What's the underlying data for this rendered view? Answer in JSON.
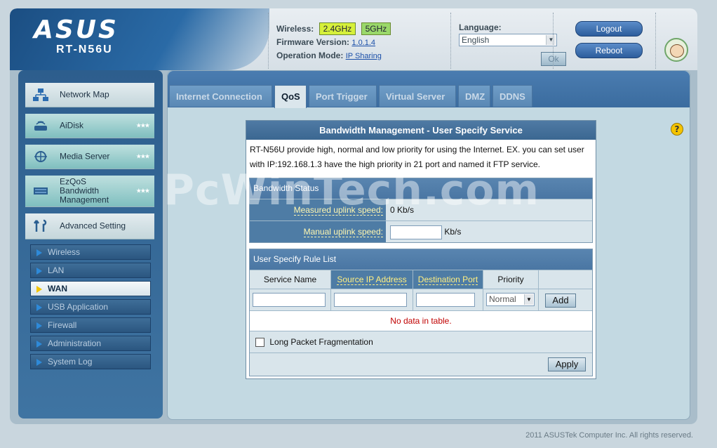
{
  "brand": {
    "logo": "ASUS",
    "model": "RT-N56U"
  },
  "header": {
    "wireless_label": "Wireless:",
    "band_24": "2.4GHz",
    "band_5": "5GHz",
    "firmware_label": "Firmware Version:",
    "firmware_value": "1.0.1.4",
    "opmode_label": "Operation Mode:",
    "opmode_value": "IP Sharing",
    "language_label": "Language:",
    "language_value": "English",
    "ok_label": "Ok",
    "logout_label": "Logout",
    "reboot_label": "Reboot"
  },
  "sidebar": {
    "items": [
      {
        "label": "Network Map",
        "icon": "network-map-icon"
      },
      {
        "label": "AiDisk",
        "icon": "aidisk-icon"
      },
      {
        "label": "Media Server",
        "icon": "media-server-icon"
      },
      {
        "label": "EzQoS Bandwidth Management",
        "icon": "ezqos-icon"
      },
      {
        "label": "Advanced Setting",
        "icon": "tools-icon"
      }
    ],
    "sub_items": [
      {
        "label": "Wireless"
      },
      {
        "label": "LAN"
      },
      {
        "label": "WAN",
        "active": true
      },
      {
        "label": "USB Application"
      },
      {
        "label": "Firewall"
      },
      {
        "label": "Administration"
      },
      {
        "label": "System Log"
      }
    ]
  },
  "tabs": [
    {
      "label": "Internet Connection"
    },
    {
      "label": "QoS",
      "active": true
    },
    {
      "label": "Port Trigger"
    },
    {
      "label": "Virtual Server"
    },
    {
      "label": "DMZ"
    },
    {
      "label": "DDNS"
    }
  ],
  "panel": {
    "title": "Bandwidth Management - User Specify Service",
    "description": "RT-N56U provide high, normal and low priority for using the Internet. EX. you can set user with IP:192.168.1.3 have the high priority in 21 port and named it FTP service.",
    "bandwidth_status": {
      "header": "Bandwidth Status",
      "measured_label": "Measured uplink speed:",
      "measured_value": "0 Kb/s",
      "manual_label": "Manual uplink speed:",
      "manual_unit": "Kb/s",
      "manual_value": ""
    },
    "rule_list": {
      "header": "User Specify Rule List",
      "columns": [
        "Service Name",
        "Source IP Address",
        "Destination Port",
        "Priority"
      ],
      "priority_selected": "Normal",
      "add_label": "Add",
      "empty_message": "No data in table.",
      "fragmentation_label": "Long Packet Fragmentation",
      "fragmentation_checked": false,
      "apply_label": "Apply"
    }
  },
  "help_icon_glyph": "?",
  "watermark": "PcWinTech.com",
  "footer": "2011 ASUSTek Computer Inc. All rights reserved.",
  "colors": {
    "accent": "#2c5d9c",
    "band_24": "#d6f03a",
    "band_5": "#9ad86a",
    "warning_text": "#c00000"
  }
}
